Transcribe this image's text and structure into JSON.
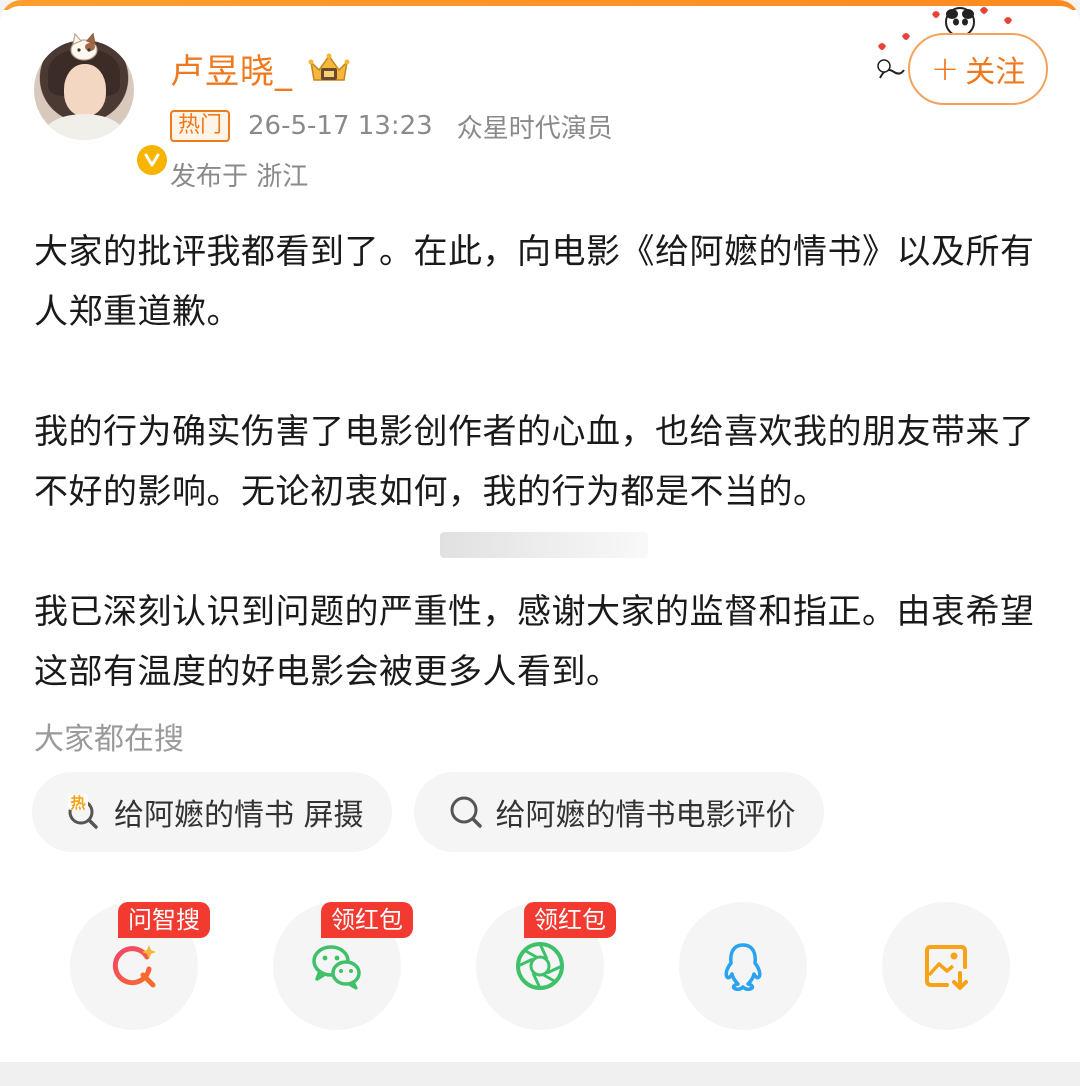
{
  "user": {
    "name": "卢昱晓_",
    "hot_tag": "热门",
    "time": "26-5-17 13:23",
    "source": "众星时代演员",
    "location": "发布于 浙江"
  },
  "follow": {
    "plus": "+",
    "label": "关注"
  },
  "post": {
    "paragraphs": [
      "大家的批评我都看到了。在此，向电影《给阿嬷的情书》以及所有人郑重道歉。",
      "我的行为确实伤害了电影创作者的心血，也给喜欢我的朋友带来了不好的影响。无论初衷如何，我的行为都是不当的。",
      "我已深刻认识到问题的严重性，感谢大家的监督和指正。由衷希望这部有温度的好电影会被更多人看到。"
    ]
  },
  "search": {
    "title": "大家都在搜",
    "chips": [
      {
        "label": "给阿嬷的情书 屏摄",
        "icon": "hot-search-icon"
      },
      {
        "label": "给阿嬷的情书电影评价",
        "icon": "search-icon"
      }
    ]
  },
  "share": {
    "items": [
      {
        "icon": "ai-search-icon",
        "tag": "问智搜"
      },
      {
        "icon": "wechat-icon",
        "tag": "领红包"
      },
      {
        "icon": "moments-icon",
        "tag": "领红包"
      },
      {
        "icon": "qq-icon",
        "tag": ""
      },
      {
        "icon": "save-image-icon",
        "tag": ""
      }
    ]
  },
  "colors": {
    "accent": "#f0791e",
    "badge": "#f7b500",
    "tag_red": "#f23a30",
    "wechat_green": "#3fc16a",
    "qq_blue": "#2aa3f0",
    "save_orange": "#f7a318"
  }
}
